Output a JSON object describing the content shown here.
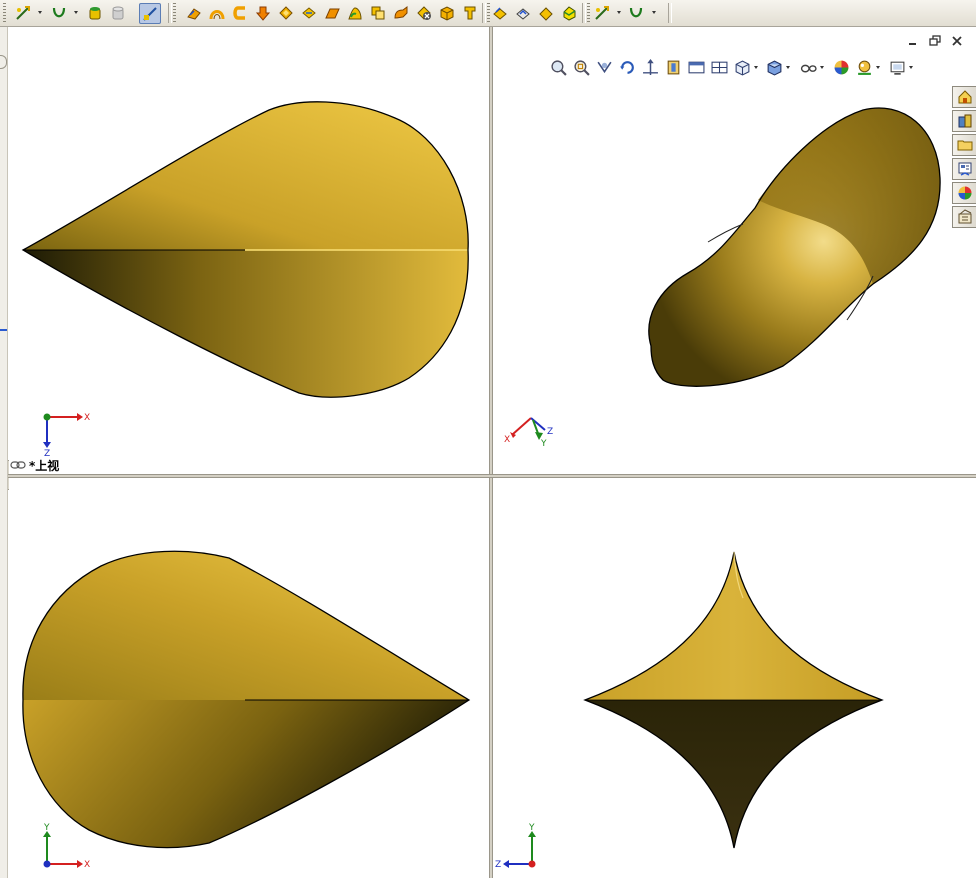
{
  "toolbar": {
    "groups": [
      {
        "name": "sketch-group",
        "items": [
          "smart-dimension-icon",
          "spline-icon",
          "extrude-boss-icon",
          "extrude-cut-icon"
        ]
      },
      {
        "name": "features-group",
        "items": [
          "instant3d-icon",
          "fillet-icon",
          "sweep-icon",
          "loft-icon",
          "revolve-icon",
          "shell-icon",
          "rib-icon",
          "draft-icon",
          "dome-icon",
          "wrap-icon",
          "flex-icon",
          "intersect-icon",
          "move-face-icon",
          "deform-icon"
        ]
      },
      {
        "name": "surface-group",
        "items": [
          "offset-surface-icon",
          "knit-surface-icon",
          "fill-surface-icon",
          "thicken-icon"
        ]
      },
      {
        "name": "sketch-group-2",
        "items": [
          "smart-dimension-icon",
          "spline-icon"
        ]
      }
    ]
  },
  "viewports": {
    "top_left": {
      "view_label": "*上视",
      "triad": {
        "x": "X",
        "y": "Z"
      }
    },
    "top_right": {
      "triad": {
        "x": "X",
        "y": "Y",
        "z": "Z"
      }
    },
    "bottom_left": {
      "triad": {
        "x": "X",
        "y": "Y"
      }
    },
    "bottom_right": {
      "triad": {
        "y": "Y",
        "z": "Z"
      }
    }
  },
  "window_controls": [
    "minimize-icon",
    "restore-icon",
    "close-icon"
  ],
  "heads_up_toolbar": [
    "zoom-to-fit-icon",
    "zoom-to-area-icon",
    "previous-view-icon",
    "rotate-view-icon",
    "pan-view-icon",
    "section-view-icon",
    "single-view-icon",
    "two-view-icon",
    "view-orientation-icon",
    "display-style-icon",
    "hide-show-items-icon",
    "edit-appearance-icon",
    "apply-scene-icon",
    "view-settings-icon"
  ],
  "task_pane": [
    "solidworks-resources-icon",
    "design-library-icon",
    "file-explorer-icon",
    "view-palette-icon",
    "appearances-icon",
    "custom-properties-icon"
  ],
  "colors": {
    "surface_light": "#e8c44a",
    "surface_mid": "#c9a128",
    "surface_dark": "#1c1a05",
    "axis_x": "#d42020",
    "axis_y": "#1e8a1e",
    "axis_z": "#1f2fc0",
    "toolbar_bg": "#e8e4d8"
  }
}
